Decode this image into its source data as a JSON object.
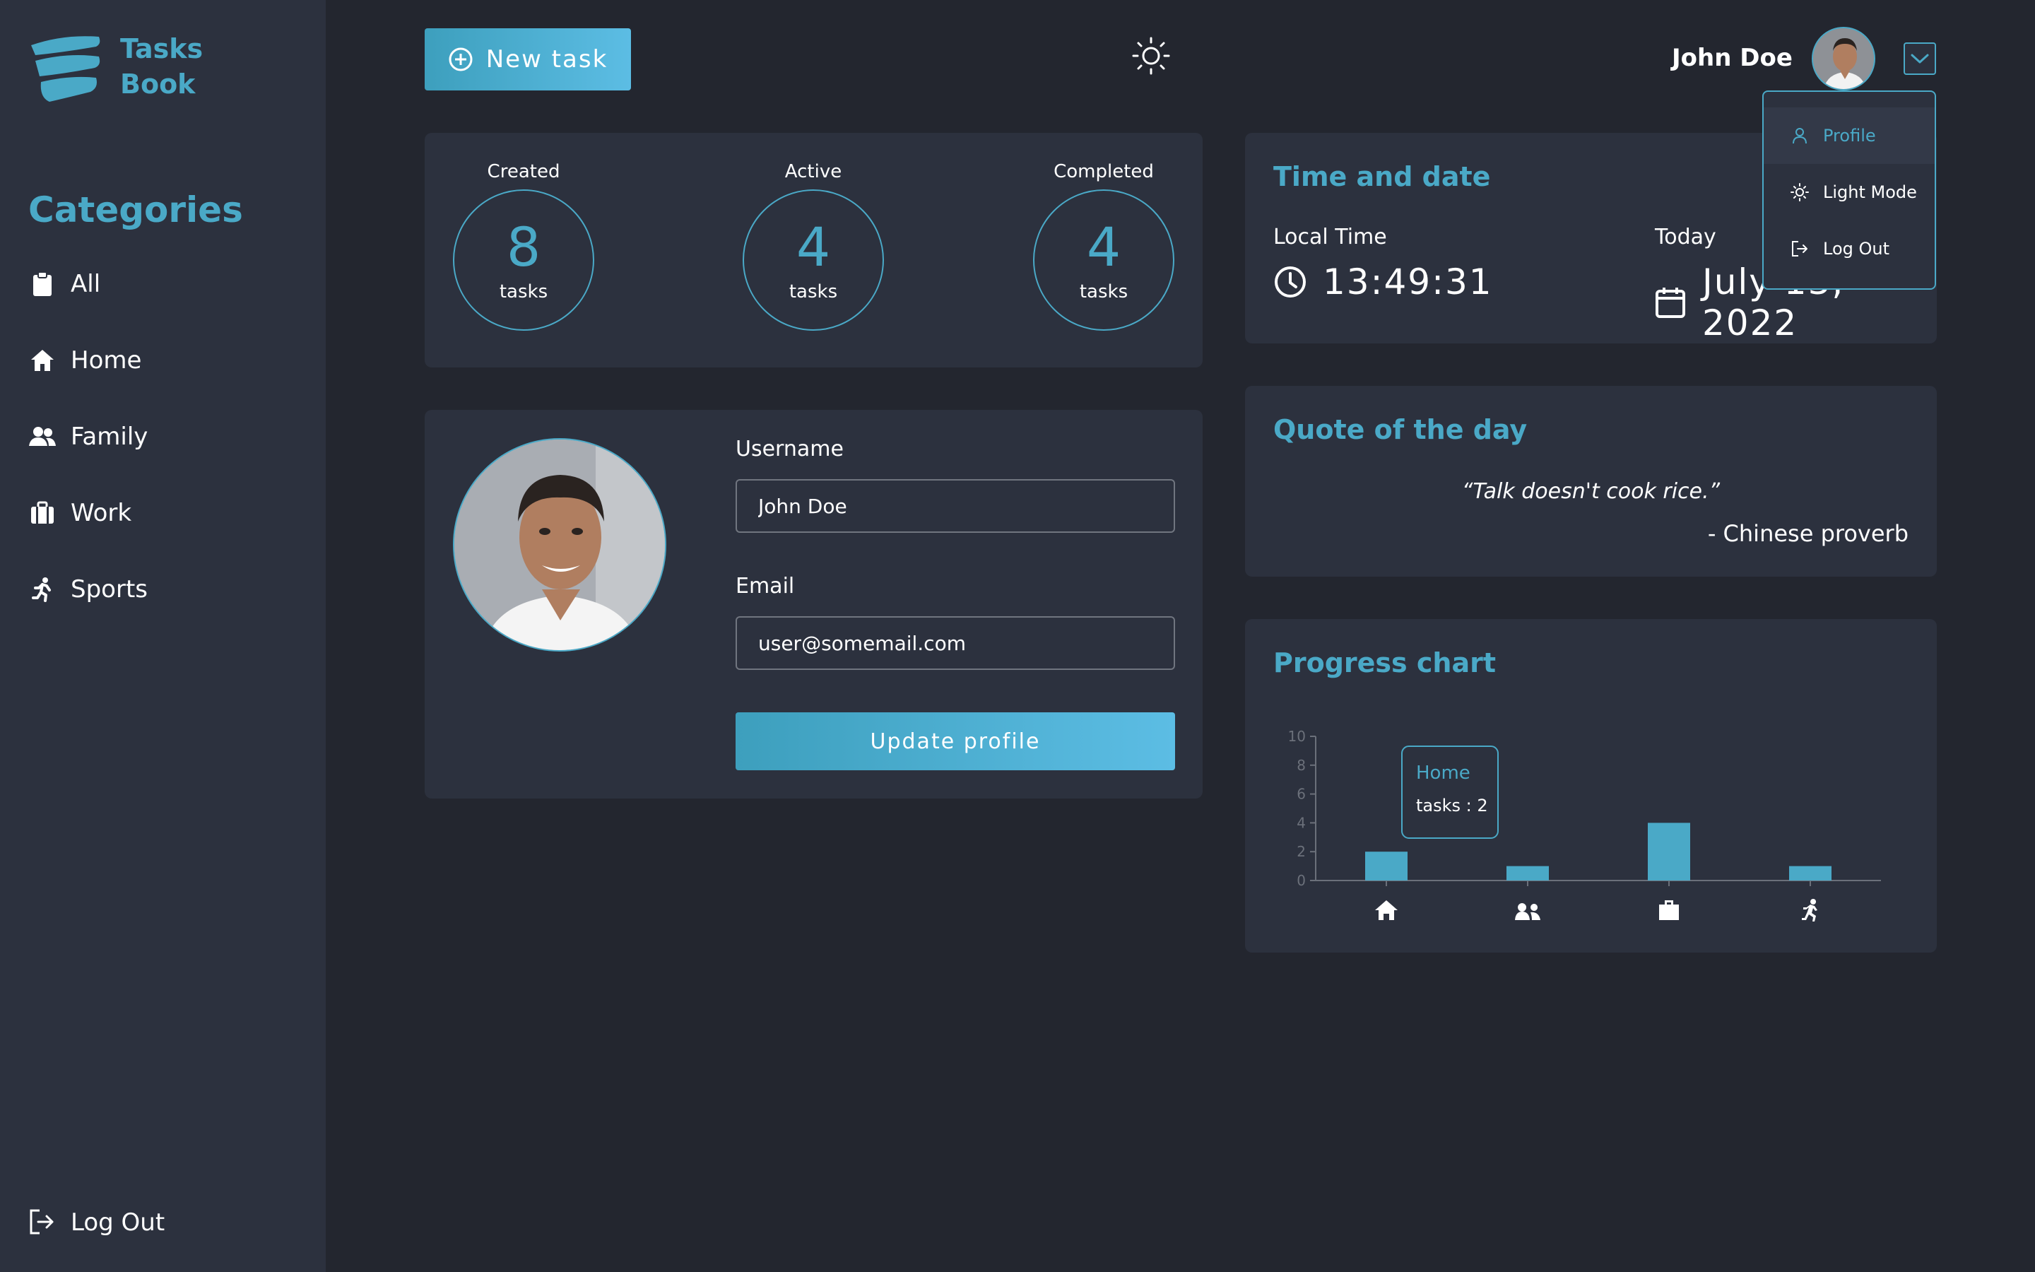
{
  "app": {
    "logo_line1": "Tasks",
    "logo_line2": "Book"
  },
  "sidebar": {
    "categories_title": "Categories",
    "items": [
      {
        "label": "All",
        "icon": "clipboard-icon"
      },
      {
        "label": "Home",
        "icon": "home-icon"
      },
      {
        "label": "Family",
        "icon": "family-icon"
      },
      {
        "label": "Work",
        "icon": "briefcase-icon"
      },
      {
        "label": "Sports",
        "icon": "running-icon"
      }
    ],
    "logout_label": "Log Out"
  },
  "header": {
    "new_task_label": "New task",
    "user_name": "John Doe"
  },
  "stats": [
    {
      "label": "Created",
      "value": "8",
      "unit": "tasks"
    },
    {
      "label": "Active",
      "value": "4",
      "unit": "tasks"
    },
    {
      "label": "Completed",
      "value": "4",
      "unit": "tasks"
    }
  ],
  "profile": {
    "username_label": "Username",
    "username_value": "John Doe",
    "email_label": "Email",
    "email_value": "user@somemail.com",
    "update_label": "Update profile"
  },
  "time_card": {
    "title": "Time and date",
    "local_time_label": "Local Time",
    "local_time_value": "13:49:31",
    "today_label": "Today",
    "today_value": "July 13, 2022"
  },
  "quote_card": {
    "title": "Quote of the day",
    "quote": "“Talk doesn't cook rice.”",
    "author": "- Chinese proverb"
  },
  "chart_card": {
    "title": "Progress chart",
    "tooltip_category": "Home",
    "tooltip_value": "tasks : 2"
  },
  "chart_data": {
    "type": "bar",
    "categories": [
      "Home",
      "Family",
      "Work",
      "Sports"
    ],
    "category_icons": [
      "home-icon",
      "family-icon",
      "briefcase-icon",
      "running-icon"
    ],
    "values": [
      2,
      1,
      4,
      1
    ],
    "ylim": [
      0,
      10
    ],
    "yticks": [
      "0",
      "2",
      "4",
      "6",
      "8",
      "10"
    ],
    "title": "",
    "xlabel": "",
    "ylabel": ""
  },
  "dropdown_menu": {
    "items": [
      {
        "label": "Profile",
        "icon": "user-icon"
      },
      {
        "label": "Light Mode",
        "icon": "sun-icon"
      },
      {
        "label": "Log Out",
        "icon": "logout-icon"
      }
    ]
  },
  "colors": {
    "accent": "#4aa9c7",
    "background": "#23262f",
    "panel": "#2c313e"
  }
}
